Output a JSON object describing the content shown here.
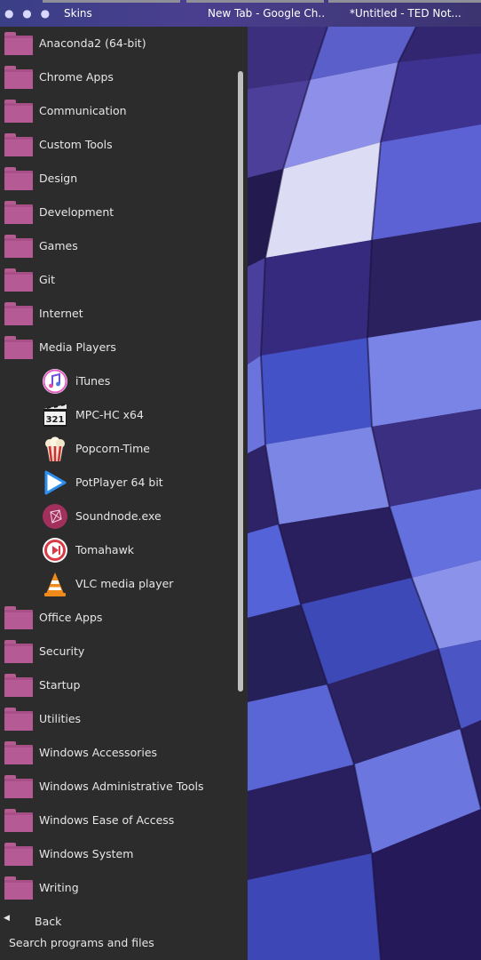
{
  "taskbar": {
    "tasks": [
      {
        "label": "Skins"
      },
      {
        "label": "New Tab - Google Ch..."
      },
      {
        "label": "*Untitled - TED Not..."
      }
    ]
  },
  "menu": {
    "folders_top": [
      {
        "label": "Anaconda2 (64-bit)"
      },
      {
        "label": "Chrome Apps"
      },
      {
        "label": "Communication"
      },
      {
        "label": "Custom Tools"
      },
      {
        "label": "Design"
      },
      {
        "label": "Development"
      },
      {
        "label": "Games"
      },
      {
        "label": "Git"
      },
      {
        "label": "Internet"
      },
      {
        "label": "Media Players"
      }
    ],
    "media_apps": [
      {
        "label": "iTunes",
        "icon": "itunes-icon"
      },
      {
        "label": "MPC-HC x64",
        "icon": "mpc-hc-icon"
      },
      {
        "label": "Popcorn-Time",
        "icon": "popcorn-time-icon"
      },
      {
        "label": "PotPlayer 64 bit",
        "icon": "potplayer-icon"
      },
      {
        "label": "Soundnode.exe",
        "icon": "soundnode-icon"
      },
      {
        "label": "Tomahawk",
        "icon": "tomahawk-icon"
      },
      {
        "label": "VLC media player",
        "icon": "vlc-icon"
      }
    ],
    "folders_bottom": [
      {
        "label": "Office Apps"
      },
      {
        "label": "Security"
      },
      {
        "label": "Startup"
      },
      {
        "label": "Utilities"
      },
      {
        "label": "Windows Accessories"
      },
      {
        "label": "Windows Administrative Tools"
      },
      {
        "label": "Windows Ease of Access"
      },
      {
        "label": "Windows System"
      },
      {
        "label": "Writing"
      }
    ],
    "back_label": "Back",
    "search_placeholder": "Search programs and files",
    "mpc_badge": "321"
  },
  "colors": {
    "folder": "#a94f88",
    "panel": "#2c2c2c",
    "wallpaper_dark": "#2a1f5e",
    "wallpaper_light": "#6a78d8"
  }
}
